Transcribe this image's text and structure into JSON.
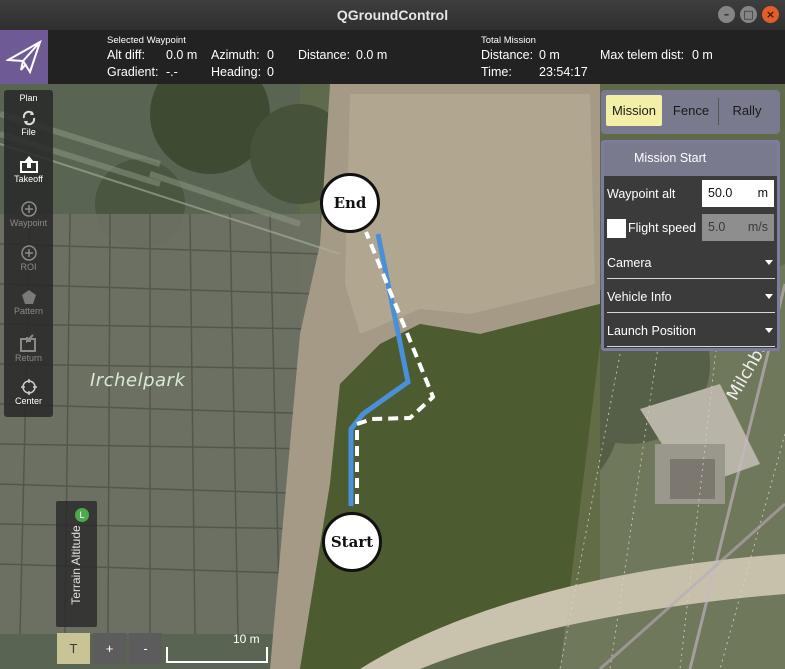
{
  "window": {
    "title": "QGroundControl"
  },
  "toolbar": {
    "selected_waypoint_label": "Selected Waypoint",
    "alt_diff_label": "Alt diff:",
    "alt_diff_value": "0.0 m",
    "azimuth_label": "Azimuth:",
    "azimuth_value": "0",
    "distance_label": "Distance:",
    "distance_value": "0.0 m",
    "gradient_label": "Gradient:",
    "gradient_value": "-.-",
    "heading_label": "Heading:",
    "heading_value": "0",
    "total_mission_label": "Total Mission",
    "total_distance_label": "Distance:",
    "total_distance_value": "0 m",
    "max_telem_label": "Max telem dist:",
    "max_telem_value": "0 m",
    "time_label": "Time:",
    "time_value": "23:54:17"
  },
  "tools": [
    {
      "label": "Plan",
      "icon": "plan-icon",
      "enabled": true
    },
    {
      "label": "File",
      "icon": "sync-icon",
      "enabled": true
    },
    {
      "label": "Takeoff",
      "icon": "takeoff-icon",
      "enabled": true
    },
    {
      "label": "Waypoint",
      "icon": "plus-circle-icon",
      "enabled": false
    },
    {
      "label": "ROI",
      "icon": "plus-circle-icon",
      "enabled": false
    },
    {
      "label": "Pattern",
      "icon": "pentagon-icon",
      "enabled": false
    },
    {
      "label": "Return",
      "icon": "return-icon",
      "enabled": false
    },
    {
      "label": "Center",
      "icon": "crosshair-icon",
      "enabled": true
    }
  ],
  "tabs": {
    "mission": "Mission",
    "fence": "Fence",
    "rally": "Rally",
    "active": "Mission"
  },
  "mission_panel": {
    "title": "Mission Start",
    "waypoint_alt_label": "Waypoint alt",
    "waypoint_alt_value": "50.0",
    "waypoint_alt_unit": "m",
    "flight_speed_label": "Flight speed",
    "flight_speed_value": "5.0",
    "flight_speed_unit": "m/s",
    "sections": [
      "Camera",
      "Vehicle Info",
      "Launch Position"
    ]
  },
  "map": {
    "park_label": "Irchelpark",
    "street_label_1": "Milchbu",
    "waypoint_start": "Start",
    "waypoint_end": "End",
    "terrain_label": "Terrain Altitude",
    "terrain_badge": "L",
    "zoom_t": "T",
    "zoom_in": "+",
    "zoom_out": "-",
    "scale_label": "10 m"
  },
  "colors": {
    "accent": "#6e5b95",
    "active_tab": "#f4efa6",
    "path": "#4a90d9"
  }
}
